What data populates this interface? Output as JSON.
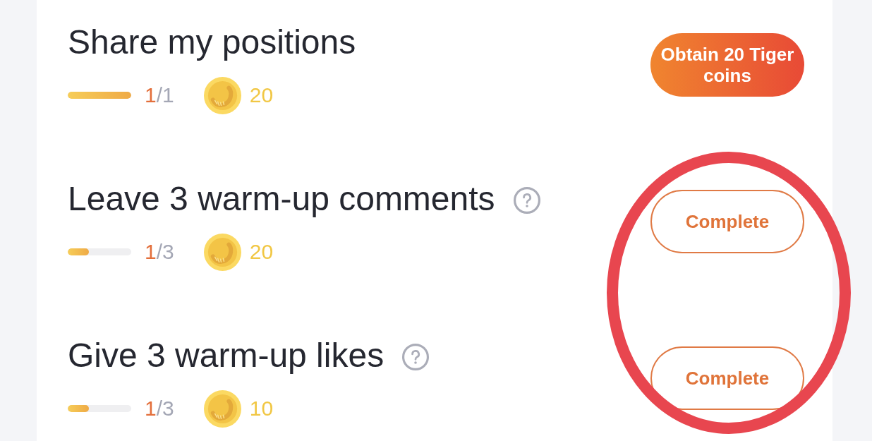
{
  "tasks": [
    {
      "title": "Share my positions",
      "has_help": false,
      "progress": {
        "level": 1,
        "done": "1",
        "rest": "/1"
      },
      "reward": "20",
      "action": {
        "kind": "claim",
        "label": "Obtain 20 Tiger coins"
      }
    },
    {
      "title": "Leave 3 warm-up comments",
      "has_help": true,
      "progress": {
        "level": 0.33,
        "done": "1",
        "rest": "/3"
      },
      "reward": "20",
      "action": {
        "kind": "complete",
        "label": "Complete"
      }
    },
    {
      "title": "Give 3 warm-up likes",
      "has_help": true,
      "progress": {
        "level": 0.33,
        "done": "1",
        "rest": "/3"
      },
      "reward": "10",
      "action": {
        "kind": "complete",
        "label": "Complete"
      }
    }
  ],
  "annotation": {
    "kind": "ellipse"
  }
}
